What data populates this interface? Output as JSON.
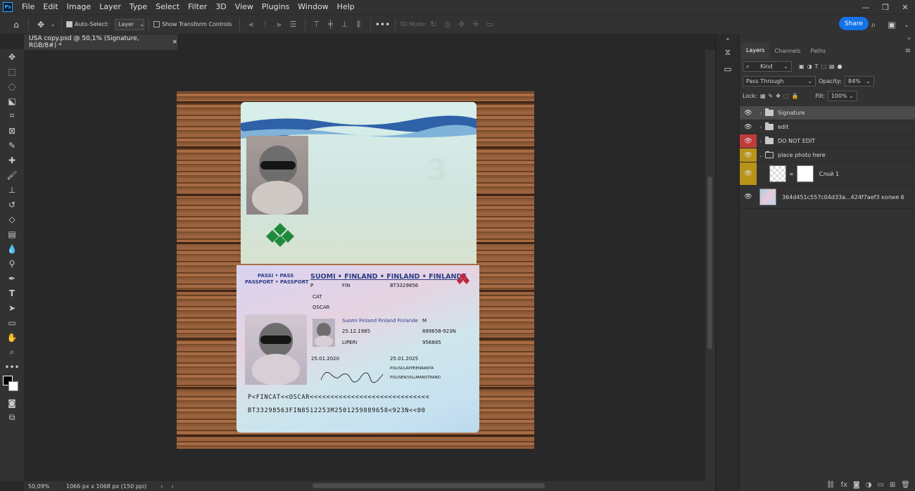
{
  "menu": {
    "items": [
      "File",
      "Edit",
      "Image",
      "Layer",
      "Type",
      "Select",
      "Filter",
      "3D",
      "View",
      "Plugins",
      "Window",
      "Help"
    ]
  },
  "window_controls": [
    "—",
    "❐",
    "✕"
  ],
  "options": {
    "auto_select_label": "Auto-Select:",
    "auto_select_target": "Layer",
    "show_transform_label": "Show Transform Controls",
    "mode_3d_label": "3D Mode:",
    "share_label": "Share"
  },
  "document": {
    "tab_title": "USA  copy.psd @ 50,1% (Signature, RGB/8#) *",
    "close_glyph": "×"
  },
  "status": {
    "zoom": "50,09%",
    "doc_info": "1066 px x 1068 px (150 ppi)"
  },
  "layers_panel": {
    "tabs": [
      "Layers",
      "Channels",
      "Paths"
    ],
    "filter_kind": "Kind",
    "blend_mode": "Pass Through",
    "opacity_label": "Opacity:",
    "opacity_value": "84%",
    "lock_label": "Lock:",
    "fill_label": "Fill:",
    "fill_value": "100%",
    "layers": [
      {
        "name": "Signature",
        "type": "group",
        "visibility_color": "none",
        "selected": true
      },
      {
        "name": "edit",
        "type": "group",
        "visibility_color": "none"
      },
      {
        "name": "DO NOT EDIT",
        "type": "group",
        "visibility_color": "#c13b3b"
      },
      {
        "name": "place photo here",
        "type": "group-open",
        "visibility_color": "#b79419"
      },
      {
        "name": "Слой 1",
        "type": "layer-with-mask",
        "visibility_color": "#b79419"
      },
      {
        "name": "364d451c557c04d33a...424f7aef3 копия 6",
        "type": "image-layer",
        "visibility_color": "none"
      }
    ]
  },
  "passport": {
    "page_number": "3",
    "header_left_1": "PASSI • PASS",
    "header_left_2": "PASSPORT • PASSPORT",
    "header_country": "SUOMI • FINLAND • FINLAND • FINLANDE",
    "type": "P",
    "code": "FIN",
    "passport_no": "BT3329856",
    "surname": "CAT",
    "given_names": "OSCAR",
    "nationality": "Suomi Finland Finland Finlande",
    "sex": "M",
    "birth_date": "25.12.1985",
    "personal_code": "889658-923N",
    "birth_place": "LIPERI",
    "height": "956885",
    "issue_date": "25.01.2020",
    "expiry_date": "25.01.2025",
    "authority_1": "POLISI/LAPPEENRANTA",
    "authority_2": "POLISEN/VILLMANSTRAND",
    "signature": "Quebert Davis",
    "mrz_1": "P<FINCAT<<OSCAR<<<<<<<<<<<<<<<<<<<<<<<<<<<<<",
    "mrz_2": "BT33298563FIN8512253M2501259889658<923N<<00"
  },
  "colors": {
    "accent": "#1473e6",
    "ps_blue": "#31a8ff",
    "vis_red": "#c13b3b",
    "vis_yellow": "#b79419"
  }
}
